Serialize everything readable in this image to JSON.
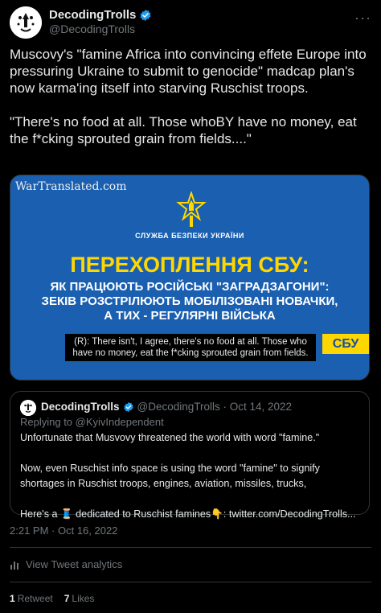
{
  "author": {
    "display_name": "DecodingTrolls",
    "handle": "@DecodingTrolls"
  },
  "more_label": "···",
  "tweet_text": "Muscovy's \"famine Africa into convincing effete Europe into pressuring Ukraine to submit to genocide\" madcap plan's now karma'ing itself into starving Ruschist troops.\n\n\"There's no food at all. Those whoBY have no money, eat the f*cking sprouted grain from fields....\"",
  "media": {
    "watermark": "WarTranslated.com",
    "org_label": "СЛУЖБА БЕЗПЕКИ УКРАЇНИ",
    "headline_1": "ПЕРЕХОПЛЕННЯ СБУ:",
    "headline_2": "ЯК ПРАЦЮЮТЬ РОСІЙСЬКІ \"ЗАГРАДЗАГОНИ\":",
    "headline_3": "ЗЕКІВ РОЗСТРІЛЮЮТЬ МОБІЛІЗОВАНІ НОВАЧКИ,",
    "headline_4": "А ТИХ - РЕГУЛЯРНІ ВІЙСЬКА",
    "subtitle": "(R): There isn't, I agree, there's no food at all. Those who have no money, eat the f*cking sprouted grain from fields.",
    "tag": "СБУ",
    "colors": {
      "background": "#1a5fb0",
      "accent": "#ffd700"
    }
  },
  "quote": {
    "display_name": "DecodingTrolls",
    "handle_time": "@DecodingTrolls · Oct 14, 2022",
    "replying_to": "Replying to @KyivIndependent",
    "text": "Unfortunate that Musvovy threatened the world with word \"famine.\"\n\nNow, even Ruschist info space is using the word \"famine\" to signify shortages in Ruschist troops, engines, aviation, missiles, trucks,\n\nHere's a 🧵 dedicated to Ruschist famines👇: twitter.com/DecodingTrolls..."
  },
  "timestamp": "2:21 PM · Oct 16, 2022",
  "analytics_label": "View Tweet analytics",
  "stats": {
    "retweets_count": "1",
    "retweets_label": "Retweet",
    "likes_count": "7",
    "likes_label": "Likes"
  },
  "colors": {
    "verified": "#1d9bf0",
    "muted_text": "#71767b"
  }
}
